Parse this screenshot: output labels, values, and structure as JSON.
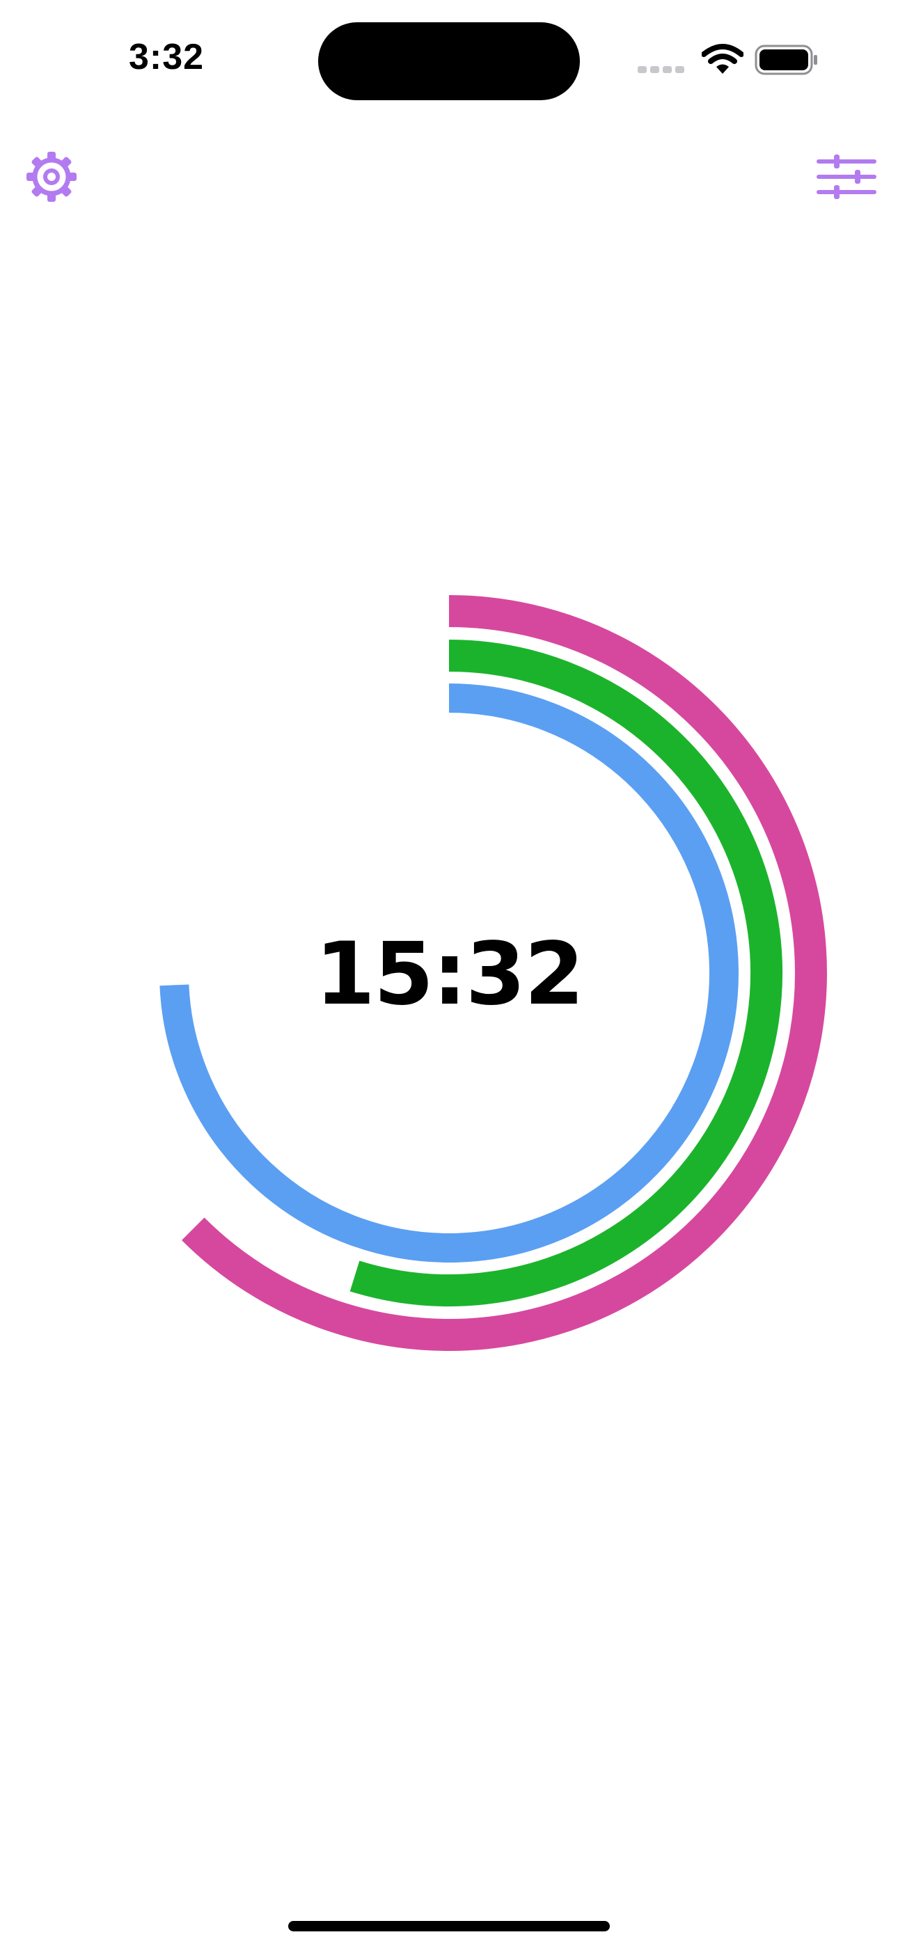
{
  "status_bar": {
    "time": "3:32",
    "icons": [
      "cellular-signal-icon",
      "wifi-icon",
      "battery-icon"
    ]
  },
  "toolbar": {
    "left_icon": "gear-icon",
    "right_icon": "sliders-icon",
    "accent_color": "#B27BF0"
  },
  "timer": {
    "display": "15:32",
    "rings": [
      {
        "name": "outer",
        "color": "#D6489E",
        "progress": 0.625
      },
      {
        "name": "middle",
        "color": "#1CB32C",
        "progress": 0.548
      },
      {
        "name": "inner",
        "color": "#5B9FF2",
        "progress": 0.743
      }
    ]
  }
}
